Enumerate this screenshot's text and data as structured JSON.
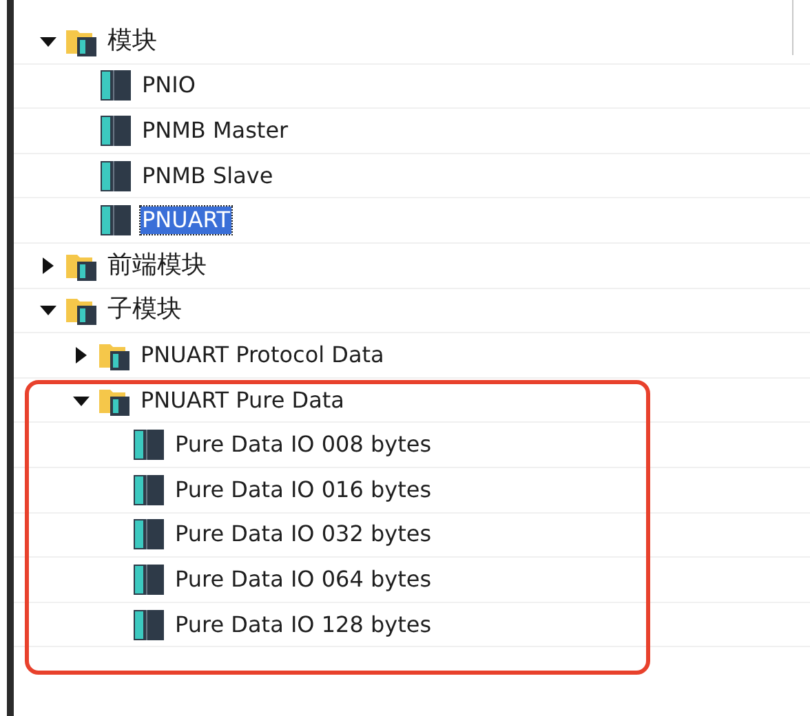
{
  "tree": [
    {
      "kind": "folder",
      "label": "模块",
      "expanded": true,
      "selected": false,
      "children": [
        {
          "kind": "module",
          "label": "PNIO",
          "selected": false
        },
        {
          "kind": "module",
          "label": "PNMB Master",
          "selected": false
        },
        {
          "kind": "module",
          "label": "PNMB Slave",
          "selected": false
        },
        {
          "kind": "module",
          "label": "PNUART",
          "selected": true
        }
      ]
    },
    {
      "kind": "folder",
      "label": "前端模块",
      "expanded": false,
      "selected": false
    },
    {
      "kind": "folder",
      "label": "子模块",
      "expanded": true,
      "selected": false,
      "children": [
        {
          "kind": "folder",
          "label": "PNUART Protocol Data",
          "expanded": false,
          "selected": false
        },
        {
          "kind": "folder",
          "label": "PNUART Pure Data",
          "expanded": true,
          "selected": false,
          "children": [
            {
              "kind": "module",
              "label": "Pure Data IO 008 bytes",
              "selected": false
            },
            {
              "kind": "module",
              "label": "Pure Data IO 016 bytes",
              "selected": false
            },
            {
              "kind": "module",
              "label": "Pure Data IO 032 bytes",
              "selected": false
            },
            {
              "kind": "module",
              "label": "Pure Data IO 064 bytes",
              "selected": false
            },
            {
              "kind": "module",
              "label": "Pure Data IO 128 bytes",
              "selected": false
            }
          ]
        }
      ]
    }
  ]
}
